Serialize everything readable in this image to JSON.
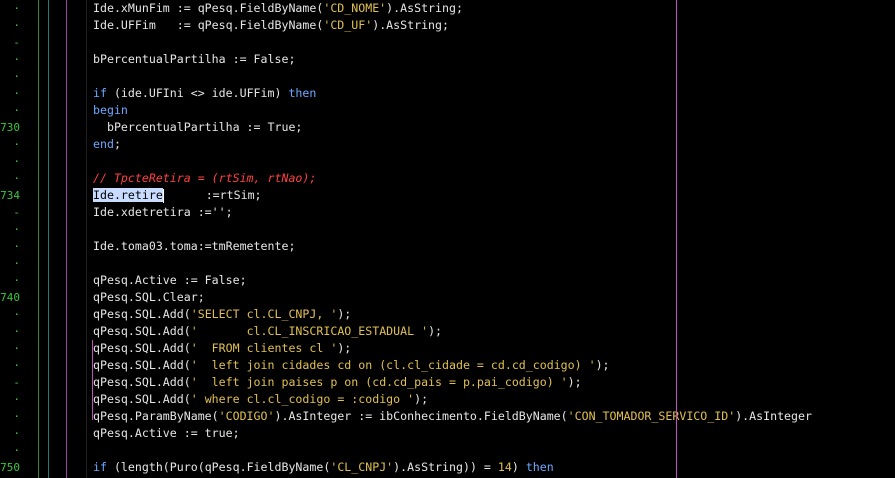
{
  "gutter": {
    "lines": [
      {
        "row": 2,
        "text": "-"
      },
      {
        "row": 7,
        "text": "730"
      },
      {
        "row": 11,
        "text": "734"
      },
      {
        "row": 12,
        "text": "-"
      },
      {
        "row": 17,
        "text": "740"
      },
      {
        "row": 22,
        "text": "-"
      },
      {
        "row": 27,
        "text": "750"
      }
    ],
    "dot_rows": [
      0,
      1,
      3,
      4,
      5,
      6,
      8,
      9,
      10,
      13,
      14,
      15,
      16,
      18,
      19,
      20,
      21,
      23,
      24,
      25,
      26
    ]
  },
  "code": [
    [
      {
        "t": "Ide.xMunFim := qPesq.FieldByName("
      },
      {
        "t": "'CD_NOME'",
        "c": "str"
      },
      {
        "t": ").AsString;"
      }
    ],
    [
      {
        "t": "Ide.UFFim   := qPesq.FieldByName("
      },
      {
        "t": "'CD_UF'",
        "c": "str"
      },
      {
        "t": ").AsString;"
      }
    ],
    [],
    [
      {
        "t": "bPercentualPartilha := False;"
      }
    ],
    [],
    [
      {
        "t": "if",
        "c": "kw"
      },
      {
        "t": " (ide.UFIni <> ide.UFFim) "
      },
      {
        "t": "then",
        "c": "kw"
      }
    ],
    [
      {
        "t": "begin",
        "c": "kw"
      }
    ],
    [
      {
        "t": "  bPercentualPartilha := True;"
      }
    ],
    [
      {
        "t": "end",
        "c": "kw"
      },
      {
        "t": ";"
      }
    ],
    [],
    [
      {
        "t": "// TpcteRetira = (rtSim, rtNao);",
        "c": "cmt"
      }
    ],
    [
      {
        "t": "Ide.retire",
        "c": "sel"
      },
      {
        "t": "      :=rtSim;"
      }
    ],
    [
      {
        "t": "Ide.xdetretira :='';"
      }
    ],
    [],
    [
      {
        "t": "Ide.toma03.toma:=tmRemetente;"
      }
    ],
    [],
    [
      {
        "t": "qPesq.Active := False;"
      }
    ],
    [
      {
        "t": "qPesq.SQL.Clear;"
      }
    ],
    [
      {
        "t": "qPesq.SQL.Add("
      },
      {
        "t": "'SELECT cl.CL_CNPJ, '",
        "c": "str"
      },
      {
        "t": ");"
      }
    ],
    [
      {
        "t": "qPesq.SQL.Add("
      },
      {
        "t": "'       cl.CL_INSCRICAO_ESTADUAL '",
        "c": "str"
      },
      {
        "t": ");"
      }
    ],
    [
      {
        "t": "qPesq.SQL.Add("
      },
      {
        "t": "'  FROM clientes cl '",
        "c": "str"
      },
      {
        "t": ");"
      }
    ],
    [
      {
        "t": "qPesq.SQL.Add("
      },
      {
        "t": "'  left join cidades cd on (cl.cl_cidade = cd.cd_codigo) '",
        "c": "str"
      },
      {
        "t": ");"
      }
    ],
    [
      {
        "t": "qPesq.SQL.Add("
      },
      {
        "t": "'  left join paises p on (cd.cd_pais = p.pai_codigo) '",
        "c": "str"
      },
      {
        "t": ");"
      }
    ],
    [
      {
        "t": "qPesq.SQL.Add("
      },
      {
        "t": "' where cl.cl_codigo = :codigo '",
        "c": "str"
      },
      {
        "t": ");"
      }
    ],
    [
      {
        "t": "qPesq.ParamByName("
      },
      {
        "t": "'CODIGO'",
        "c": "str"
      },
      {
        "t": ").AsInteger := ibConhecimento.FieldByName("
      },
      {
        "t": "'CON_TOMADOR_SERVICO_ID'",
        "c": "str"
      },
      {
        "t": ").AsInteger"
      }
    ],
    [
      {
        "t": "qPesq.Active := true;"
      }
    ],
    [],
    [
      {
        "t": "if",
        "c": "kw"
      },
      {
        "t": " (length(Puro(qPesq.FieldByName("
      },
      {
        "t": "'CL_CNPJ'",
        "c": "str"
      },
      {
        "t": ").AsString)) = "
      },
      {
        "t": "14",
        "c": "num"
      },
      {
        "t": ") "
      },
      {
        "t": "then",
        "c": "kw"
      }
    ]
  ]
}
